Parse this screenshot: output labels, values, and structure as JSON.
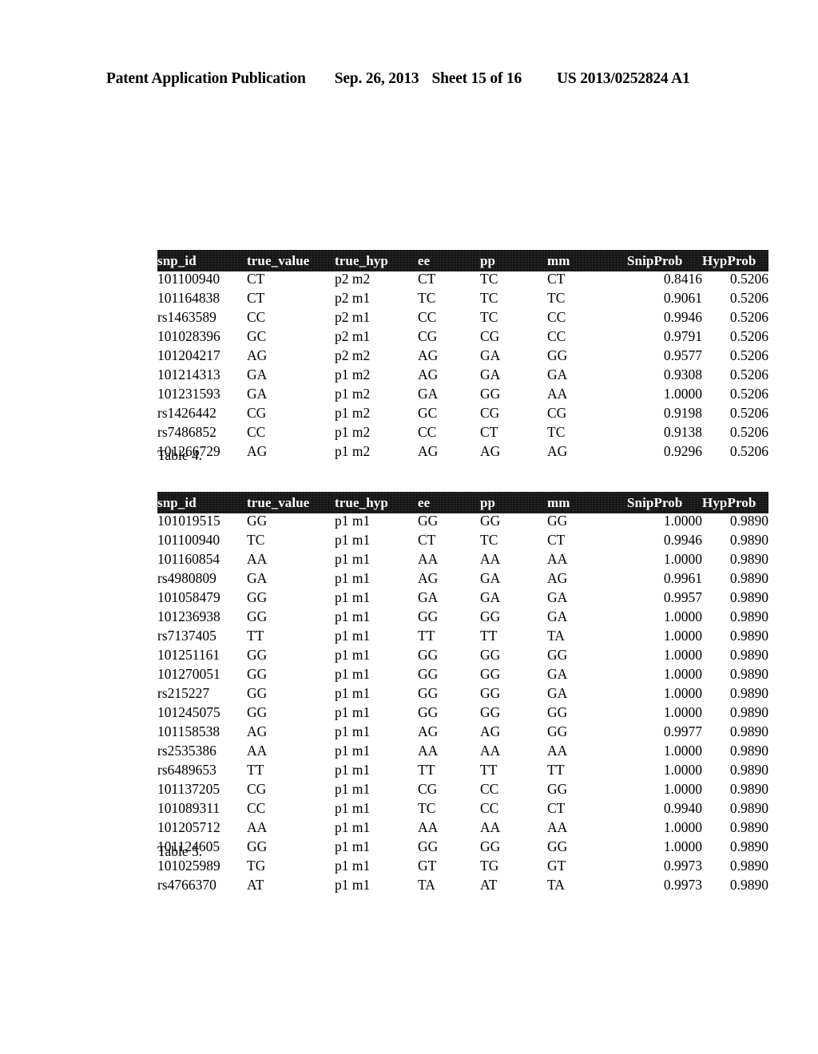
{
  "page_header": {
    "publication": "Patent Application Publication",
    "date": "Sep. 26, 2013",
    "sheet": "Sheet 15 of 16",
    "patent_number": "US 2013/0252824 A1"
  },
  "columns": [
    "snp_id",
    "true_value",
    "true_hyp",
    "ee",
    "pp",
    "mm",
    "SnipProb",
    "HypProb"
  ],
  "table4": {
    "caption": "Table 4.",
    "columns": [
      "snp_id",
      "true_value",
      "true_hyp",
      "ee",
      "pp",
      "mm",
      "SnipProb",
      "HypProb"
    ],
    "rows": [
      [
        "101100940",
        "CT",
        "p2 m2",
        "CT",
        "TC",
        "CT",
        "0.8416",
        "0.5206"
      ],
      [
        "101164838",
        "CT",
        "p2 m1",
        "TC",
        "TC",
        "TC",
        "0.9061",
        "0.5206"
      ],
      [
        "rs1463589",
        "CC",
        "p2 m1",
        "CC",
        "TC",
        "CC",
        "0.9946",
        "0.5206"
      ],
      [
        "101028396",
        "GC",
        "p2 m1",
        "CG",
        "CG",
        "CC",
        "0.9791",
        "0.5206"
      ],
      [
        "101204217",
        "AG",
        "p2 m2",
        "AG",
        "GA",
        "GG",
        "0.9577",
        "0.5206"
      ],
      [
        "101214313",
        "GA",
        "p1 m2",
        "AG",
        "GA",
        "GA",
        "0.9308",
        "0.5206"
      ],
      [
        "101231593",
        "GA",
        "p1 m2",
        "GA",
        "GG",
        "AA",
        "1.0000",
        "0.5206"
      ],
      [
        "rs1426442",
        "CG",
        "p1 m2",
        "GC",
        "CG",
        "CG",
        "0.9198",
        "0.5206"
      ],
      [
        "rs7486852",
        "CC",
        "p1 m2",
        "CC",
        "CT",
        "TC",
        "0.9138",
        "0.5206"
      ],
      [
        "101266729",
        "AG",
        "p1 m2",
        "AG",
        "AG",
        "AG",
        "0.9296",
        "0.5206"
      ]
    ]
  },
  "table5": {
    "caption": "Table 5.",
    "columns": [
      "snp_id",
      "true_value",
      "true_hyp",
      "ee",
      "pp",
      "mm",
      "SnipProb",
      "HypProb"
    ],
    "rows": [
      [
        "101019515",
        "GG",
        "p1 m1",
        "GG",
        "GG",
        "GG",
        "1.0000",
        "0.9890"
      ],
      [
        "101100940",
        "TC",
        "p1 m1",
        "CT",
        "TC",
        "CT",
        "0.9946",
        "0.9890"
      ],
      [
        "101160854",
        "AA",
        "p1 m1",
        "AA",
        "AA",
        "AA",
        "1.0000",
        "0.9890"
      ],
      [
        "rs4980809",
        "GA",
        "p1 m1",
        "AG",
        "GA",
        "AG",
        "0.9961",
        "0.9890"
      ],
      [
        "101058479",
        "GG",
        "p1 m1",
        "GA",
        "GA",
        "GA",
        "0.9957",
        "0.9890"
      ],
      [
        "101236938",
        "GG",
        "p1 m1",
        "GG",
        "GG",
        "GA",
        "1.0000",
        "0.9890"
      ],
      [
        "rs7137405",
        "TT",
        "p1 m1",
        "TT",
        "TT",
        "TA",
        "1.0000",
        "0.9890"
      ],
      [
        "101251161",
        "GG",
        "p1 m1",
        "GG",
        "GG",
        "GG",
        "1.0000",
        "0.9890"
      ],
      [
        "101270051",
        "GG",
        "p1 m1",
        "GG",
        "GG",
        "GA",
        "1.0000",
        "0.9890"
      ],
      [
        "rs215227",
        "GG",
        "p1 m1",
        "GG",
        "GG",
        "GA",
        "1.0000",
        "0.9890"
      ],
      [
        "101245075",
        "GG",
        "p1 m1",
        "GG",
        "GG",
        "GG",
        "1.0000",
        "0.9890"
      ],
      [
        "101158538",
        "AG",
        "p1 m1",
        "AG",
        "AG",
        "GG",
        "0.9977",
        "0.9890"
      ],
      [
        "rs2535386",
        "AA",
        "p1 m1",
        "AA",
        "AA",
        "AA",
        "1.0000",
        "0.9890"
      ],
      [
        "rs6489653",
        "TT",
        "p1 m1",
        "TT",
        "TT",
        "TT",
        "1.0000",
        "0.9890"
      ],
      [
        "101137205",
        "CG",
        "p1 m1",
        "CG",
        "CC",
        "GG",
        "1.0000",
        "0.9890"
      ],
      [
        "101089311",
        "CC",
        "p1 m1",
        "TC",
        "CC",
        "CT",
        "0.9940",
        "0.9890"
      ],
      [
        "101205712",
        "AA",
        "p1 m1",
        "AA",
        "AA",
        "AA",
        "1.0000",
        "0.9890"
      ],
      [
        "101124605",
        "GG",
        "p1 m1",
        "GG",
        "GG",
        "GG",
        "1.0000",
        "0.9890"
      ],
      [
        "101025989",
        "TG",
        "p1 m1",
        "GT",
        "TG",
        "GT",
        "0.9973",
        "0.9890"
      ],
      [
        "rs4766370",
        "AT",
        "p1 m1",
        "TA",
        "AT",
        "TA",
        "0.9973",
        "0.9890"
      ]
    ]
  }
}
